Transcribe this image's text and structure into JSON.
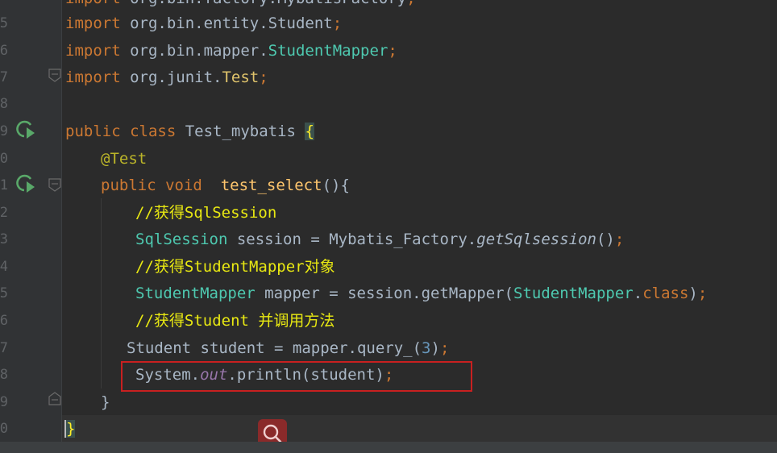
{
  "editor": {
    "line_numbers": [
      "5",
      "6",
      "7",
      "8",
      "9",
      "0",
      "1",
      "2",
      "3",
      "4",
      "5",
      "6",
      "7",
      "8",
      "9",
      "0"
    ],
    "code": {
      "l0": {
        "kw": "import",
        "pkg": " org.bin.factory.MybatisFactory",
        "end": ";"
      },
      "l1": {
        "kw": "import",
        "pkg": " org.bin.entity.Student",
        "end": ";"
      },
      "l2": {
        "kw": "import",
        "pkg": " org.bin.mapper.",
        "cls": "StudentMapper",
        "end": ";"
      },
      "l3": {
        "kw": "import",
        "pkg": " org.junit.",
        "cls": "Test",
        "end": ";"
      },
      "l4": {
        "kw1": "public",
        "kw2": " class",
        "name": " Test_mybatis ",
        "brace": "{"
      },
      "l5": {
        "annotation": "@Test"
      },
      "l6": {
        "kw1": "public",
        "kw2": " void",
        "name": "  test_select",
        "paren": "(){"
      },
      "l7": {
        "comment": "//获得SqlSession"
      },
      "l8": {
        "type": "SqlSession",
        "mid": " session = Mybatis_Factory.",
        "call": "getSqlsession",
        "tail": "()",
        "end": ";"
      },
      "l9": {
        "comment": "//获得StudentMapper对象"
      },
      "l10": {
        "type": "StudentMapper",
        "mid": " mapper = session.getMapper(",
        "type2": "StudentMapper",
        "dot": ".",
        "kw": "class",
        "tail": ")",
        "end": ";"
      },
      "l11": {
        "comment": "//获得Student 并调用方法"
      },
      "l12": {
        "mid": "Student student = mapper.query_(",
        "num": "3",
        "tail": ")",
        "end": ";"
      },
      "l13": {
        "pre": "System.",
        "field": "out",
        "mid": ".println(student)",
        "end": ";"
      },
      "l14": {
        "brace": "}"
      },
      "l15": {
        "brace": "}"
      }
    }
  },
  "colors": {
    "background": "#2b2b2b",
    "keyword": "#cc7832",
    "type": "#4ec9b0",
    "comment": "#e8e812",
    "highlight_box": "#c82020"
  },
  "icons": {
    "run": "run-test-icon",
    "fold": "fold-icon",
    "search": "search-icon"
  }
}
